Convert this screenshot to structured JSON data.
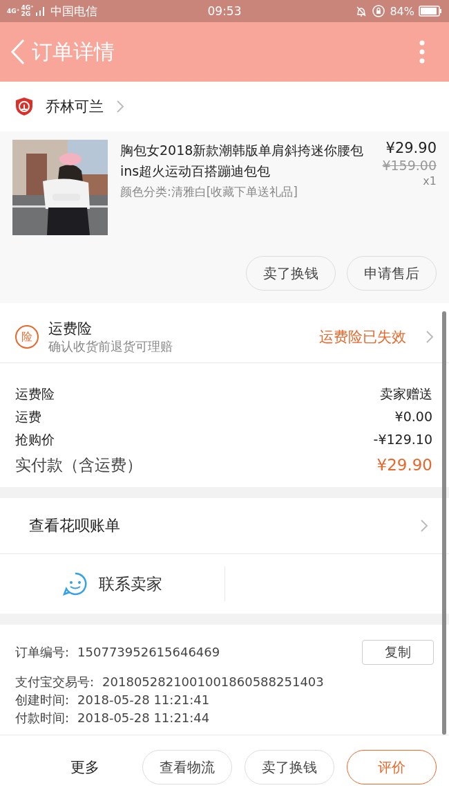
{
  "status_bar": {
    "network": [
      "4G⁺",
      "4G⁺",
      "2G"
    ],
    "carrier": "中国电信",
    "time": "09:53",
    "battery": "84%"
  },
  "header": {
    "title": "订单详情"
  },
  "shop": {
    "name": "乔林可兰"
  },
  "product": {
    "kind": "picture",
    "title": "胸包女2018新款潮韩版单肩斜挎迷你腰包ins超火运动百搭蹦迪包包",
    "price": "¥29.90",
    "original_price": "¥159.00",
    "variant": "颜色分类:清雅白[收藏下单送礼品]",
    "quantity": "x1",
    "actions": [
      "卖了换钱",
      "申请售后"
    ]
  },
  "insurance": {
    "badge": "险",
    "title": "运费险",
    "subtitle": "确认收货前退货可理赔",
    "status": "运费险已失效"
  },
  "fees": [
    {
      "label": "运费险",
      "value": "卖家赠送",
      "kind": "normal"
    },
    {
      "label": "运费",
      "value": "¥0.00",
      "kind": "normal"
    },
    {
      "label": "抢购价",
      "value": "-¥129.10",
      "kind": "normal"
    },
    {
      "label": "实付款（含运费）",
      "value": "¥29.90",
      "kind": "total"
    }
  ],
  "huabei": {
    "label": "查看花呗账单"
  },
  "contact": {
    "label": "联系卖家"
  },
  "order_info": {
    "copy_button": "复制",
    "rows": [
      {
        "label": "订单编号:",
        "value": "150773952615646469"
      },
      {
        "label": "支付宝交易号:",
        "value": "2018052821001001860588251403"
      },
      {
        "label": "创建时间:",
        "value": "2018-05-28 11:21:41"
      },
      {
        "label": "付款时间:",
        "value": "2018-05-28 11:21:44"
      }
    ]
  },
  "bottom_bar": {
    "more": "更多",
    "buttons": [
      {
        "label": "查看物流",
        "kind": "normal"
      },
      {
        "label": "卖了换钱",
        "kind": "normal"
      },
      {
        "label": "评价",
        "kind": "primary"
      }
    ]
  }
}
